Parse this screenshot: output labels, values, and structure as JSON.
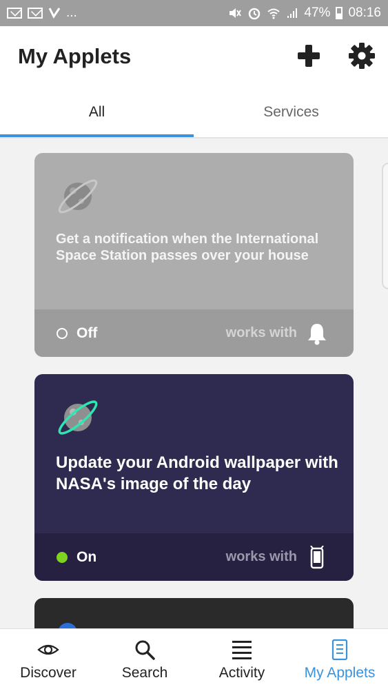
{
  "status_bar": {
    "time": "08:16",
    "battery_percent": "47%",
    "overflow_dots": "..."
  },
  "header": {
    "title": "My Applets",
    "add_icon": "plus-icon",
    "settings_icon": "gear-icon"
  },
  "tabs": [
    {
      "label": "All",
      "active": true
    },
    {
      "label": "Services",
      "active": false
    }
  ],
  "applets": [
    {
      "title": "Get a notification when the International Space Station passes over your house",
      "status": "Off",
      "works_with": "works with",
      "service_icon": "bell-icon",
      "background": "#adadad"
    },
    {
      "title": "Update your Android wallpaper with NASA's image of the day",
      "status": "On",
      "works_with": "works with",
      "service_icon": "android-phone-icon",
      "background": "#2f2a4f"
    }
  ],
  "bottom_nav": [
    {
      "label": "Discover",
      "icon": "eye-icon",
      "active": false
    },
    {
      "label": "Search",
      "icon": "search-icon",
      "active": false
    },
    {
      "label": "Activity",
      "icon": "activity-list-icon",
      "active": false
    },
    {
      "label": "My Applets",
      "icon": "applets-icon",
      "active": true
    }
  ],
  "colors": {
    "accent": "#3a92dc",
    "on_indicator": "#7ed321"
  }
}
